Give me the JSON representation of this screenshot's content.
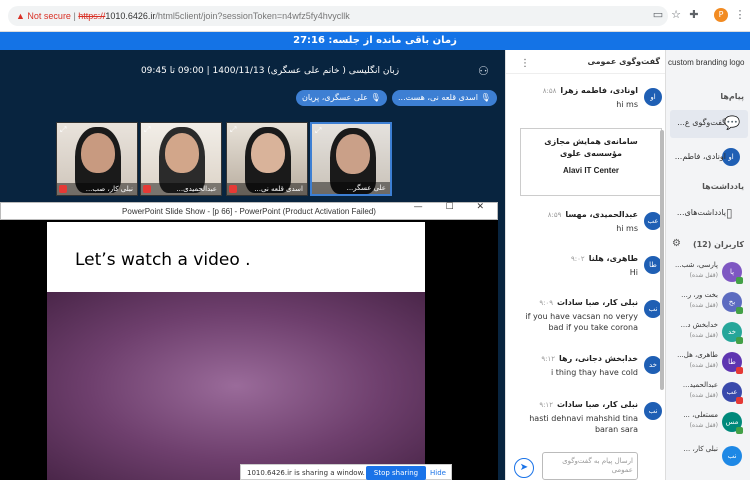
{
  "browser": {
    "security": "Not secure",
    "url_scheme": "https://",
    "url_host": "1010.6426.ir",
    "url_path": "/html5client/join?sessionToken=n4wfz5fy4hvycllk",
    "profile_initial": "P"
  },
  "timer": {
    "label": "زمان باقی مانده از جلسه: 27:16"
  },
  "session": {
    "info": "زبان انگلیسی ( خانم علی عسگری) 1400/11/13 | 09:00 تا 09:45",
    "chips": [
      "اسدی قلعه نی، هست...",
      "علی عسگری، پریان"
    ]
  },
  "tiles": [
    {
      "name": "نبلی کار، صب..."
    },
    {
      "name": "عبدالحمیدی..."
    },
    {
      "name": "اسدی قلعه نی..."
    },
    {
      "name": "علی عسگر..."
    }
  ],
  "ppt": {
    "title": "PowerPoint Slide Show - [p 66] - PowerPoint (Product Activation Failed)",
    "controls": "— ☐ ✕",
    "slide_title": "Let’s watch a video ."
  },
  "share": {
    "text": "1010.6426.ir is sharing a window.",
    "stop_label": "Stop sharing",
    "hide_label": "Hide"
  },
  "chat": {
    "header": "گفت‌وگوی عمومی",
    "system_msg": {
      "line1": "سامانه‌ی همایش مجازی",
      "line2": "مؤسسه‌ی علوی",
      "line3": "Alavi IT Center"
    },
    "messages": [
      {
        "initials": "او",
        "name": "اونادی، فاطمه زهرا",
        "time": "۸:۵۸",
        "text": "hi ms"
      },
      {
        "initials": "عب",
        "name": "عبدالحمیدی، مهسا",
        "time": "۸:۵۹",
        "text": "hi ms"
      },
      {
        "initials": "طا",
        "name": "طاهری، هلنا",
        "time": "۹:۰۲",
        "text": "Hi"
      },
      {
        "initials": "نب",
        "name": "نبلی کار، صبا سادات",
        "time": "۹:۰۹",
        "text": "if you have vacsan no veryy bad if you take corona"
      },
      {
        "initials": "خد",
        "name": "خدابخش دجانی، رها",
        "time": "۹:۱۲",
        "text": "i thing thay have cold"
      },
      {
        "initials": "نب",
        "name": "نبلی کار، صبا سادات",
        "time": "۹:۱۲",
        "text": "hasti dehnavi mahshid tina baran sara"
      }
    ],
    "input_placeholder": "ارسال پیام به گفت‌وگوی عمومی"
  },
  "sidebar": {
    "logo_alt": "custom branding logo",
    "messages_heading": "پیام‌ها",
    "public_chat": "گفت‌وگوی ع...",
    "private_chat": {
      "initials": "او",
      "label": "اونادی، فاطم..."
    },
    "notes_heading": "یادداشت‌ها",
    "notes_item": "یادداشت‌های...",
    "users_heading": "کاربران (12)",
    "users": [
      {
        "initials": "پا",
        "name": "پارسی، شب...",
        "sub": "(قفل شده)",
        "color": "#7e57c2"
      },
      {
        "initials": "بخ",
        "name": "بخت ور، ر...",
        "sub": "(قفل شده)",
        "color": "#5c6bc0"
      },
      {
        "initials": "خد",
        "name": "خدابخش د...",
        "sub": "(قفل شده)",
        "color": "#26a69a"
      },
      {
        "initials": "طا",
        "name": "طاهری، هل...",
        "sub": "(قفل شده)",
        "color": "#5e35b1"
      },
      {
        "initials": "عب",
        "name": "عبدالحمید...",
        "sub": "(قفل شده)",
        "color": "#3949ab"
      },
      {
        "initials": "مس",
        "name": "مستعلی، ...",
        "sub": "(قفل شده)",
        "color": "#00897b"
      },
      {
        "initials": "نب",
        "name": "نبلی کار، ...",
        "sub": "",
        "color": "#1e88e5"
      }
    ]
  }
}
